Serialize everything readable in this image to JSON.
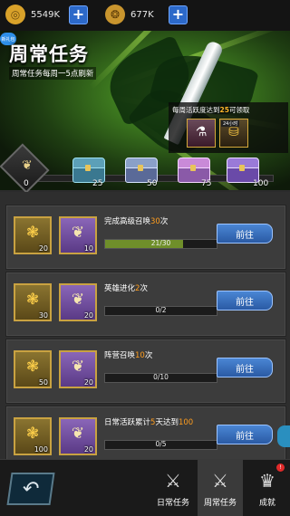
{
  "currency": [
    {
      "icon": "gold-coin-icon",
      "glyph": "◎",
      "value": "5549K",
      "color": "#d9a22a"
    },
    {
      "icon": "gem-pouch-icon",
      "glyph": "❂",
      "value": "677K",
      "color": "#c9952e"
    }
  ],
  "banner": {
    "badge": "新礼包",
    "title": "周常任务",
    "subtitle": "周常任务每周一5点刷新",
    "reward_text_prefix": "每周活跃度达到",
    "reward_threshold": "25",
    "reward_text_suffix": "可领取",
    "reward_tag": "24小时"
  },
  "activity": {
    "current": "0",
    "milestones": [
      "25",
      "50",
      "75",
      "100"
    ]
  },
  "tasks": [
    {
      "title_pre": "完成高级召唤",
      "title_hl": "30",
      "title_post": "次",
      "gold": "20",
      "feather": "10",
      "progress": "21/30",
      "progress_value": 0.7,
      "button": "前往"
    },
    {
      "title_pre": "英雄进化",
      "title_hl": "2",
      "title_post": "次",
      "gold": "30",
      "feather": "20",
      "progress": "0/2",
      "progress_value": 0,
      "button": "前往"
    },
    {
      "title_pre": "阵营召唤",
      "title_hl": "10",
      "title_post": "次",
      "gold": "50",
      "feather": "20",
      "progress": "0/10",
      "progress_value": 0,
      "button": "前往"
    },
    {
      "title_pre": "日常活跃累计",
      "title_hl": "5",
      "title_mid": "天达到",
      "title_hl2": "100",
      "title_post": "",
      "gold": "100",
      "feather": "20",
      "progress": "0/5",
      "progress_value": 0,
      "button": "前往"
    }
  ],
  "nav": {
    "daily": "日常任务",
    "weekly": "周常任务",
    "achievements": "成就",
    "badge": "!"
  },
  "colors": {
    "accent": "#ff9d1e",
    "button": "#3a72c4",
    "progress": "#6f8f2a"
  }
}
